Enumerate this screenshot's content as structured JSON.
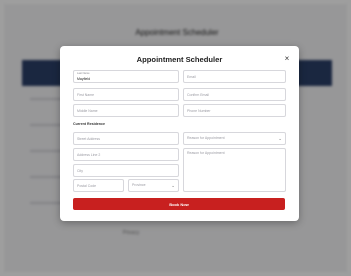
{
  "background": {
    "title": "Appointment Scheduler",
    "footer_text": "Privacy"
  },
  "modal": {
    "title": "Appointment Scheduler",
    "close_icon": "×",
    "fields": {
      "last_name": {
        "label": "Last Name",
        "value": "Mayfield"
      },
      "email": {
        "placeholder": "Email"
      },
      "first_name": {
        "placeholder": "First Name"
      },
      "confirm_email": {
        "placeholder": "Confirm Email"
      },
      "middle_name": {
        "placeholder": "Middle Name"
      },
      "phone_number": {
        "placeholder": "Phone Number"
      },
      "street_address": {
        "placeholder": "Street Address"
      },
      "reason_select": {
        "value": "Reason for Appointment"
      },
      "address_line_2": {
        "placeholder": "Address Line 2"
      },
      "reason_text": {
        "placeholder": "Reason for Appointment"
      },
      "city": {
        "placeholder": "City"
      },
      "postal_code": {
        "placeholder": "Postal Code"
      },
      "province": {
        "value": "Province"
      }
    },
    "section_label": "Current Residence",
    "submit_label": "Book Now"
  },
  "colors": {
    "accent": "#c8201f",
    "header_band": "#2b3f68",
    "overlay": "rgba(0,0,0,0.38)"
  }
}
